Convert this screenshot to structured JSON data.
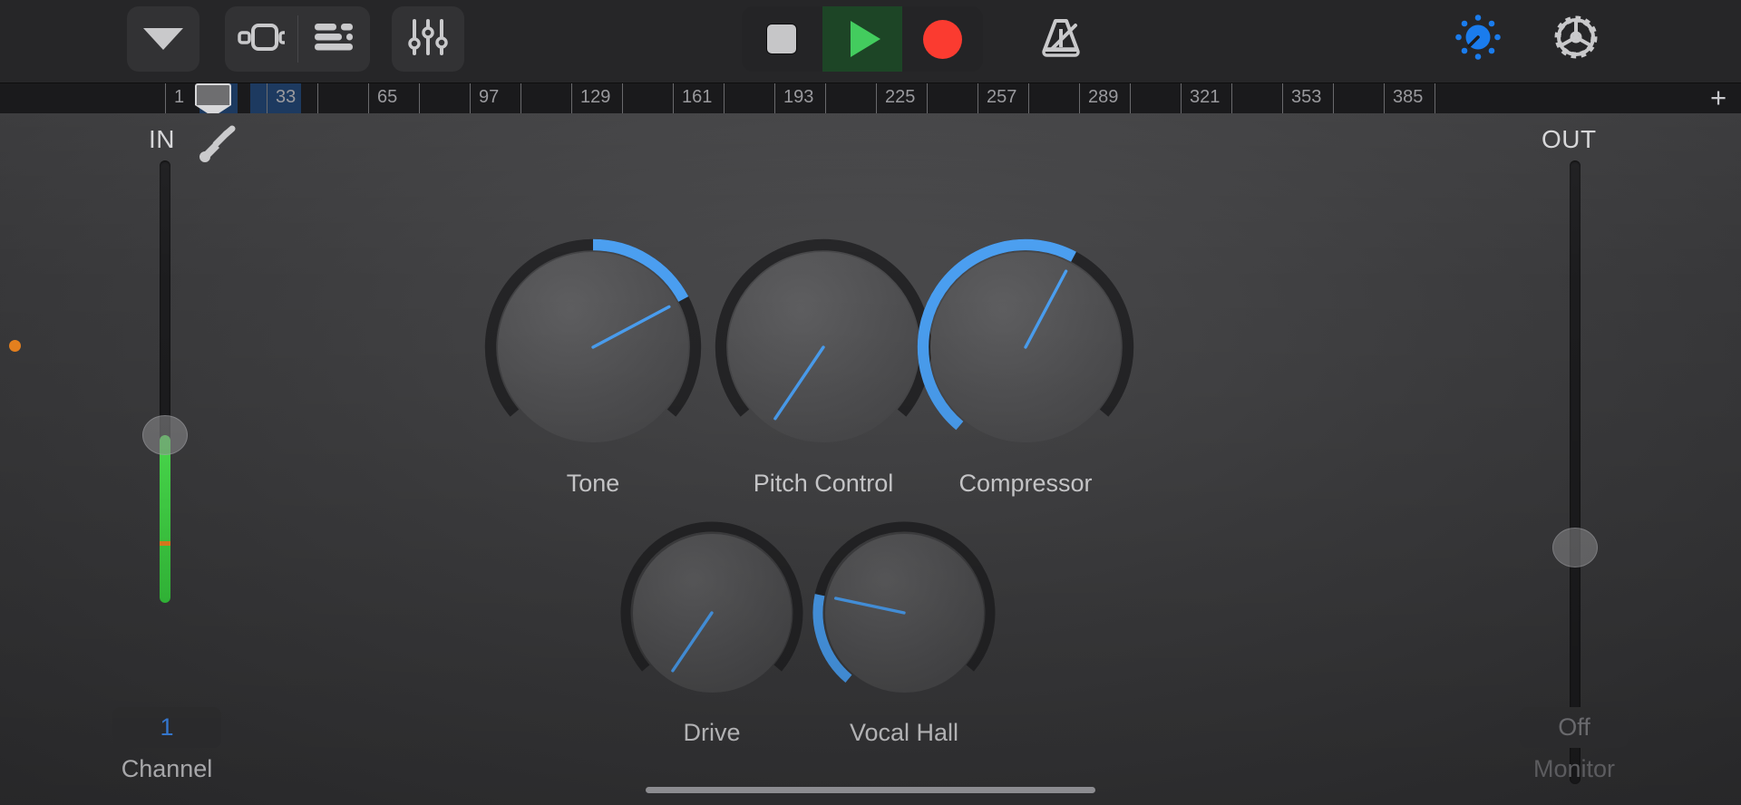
{
  "toolbar": {
    "navigation_button": "chevron-down",
    "tracks_view_button": "tracks-loop-view",
    "list_view_button": "list-view",
    "mixer_button": "mixer-sliders",
    "stop_label": "Stop",
    "play_label": "Play",
    "record_label": "Record",
    "metronome_label": "Metronome",
    "controls_label": "Track Controls",
    "settings_label": "Settings",
    "accent_blue": "#1a7ced",
    "play_green": "#43cc5e",
    "record_red": "#fb3b30"
  },
  "ruler": {
    "bars": [
      "1",
      "33",
      "65",
      "97",
      "129",
      "161",
      "193",
      "225",
      "257",
      "289",
      "321",
      "353",
      "385"
    ],
    "add_button": "+",
    "playhead_bar": "5",
    "cycle_color": "#1d3a60"
  },
  "input": {
    "label": "IN",
    "icon": "input-jack-icon",
    "fader_value": 62,
    "meter_level": 38,
    "peak_marker": 86,
    "channel_value": "1",
    "channel_label": "Channel"
  },
  "output": {
    "label": "OUT",
    "fader_value": 38,
    "monitor_value": "Off",
    "monitor_label": "Monitor"
  },
  "knobs": [
    {
      "label": "Tone",
      "arc_start": 0,
      "arc_end": 62,
      "pointer": 62,
      "has_arc": true,
      "size": 118
    },
    {
      "label": "Pitch Control",
      "arc_start": 0,
      "arc_end": 0,
      "pointer": 214,
      "has_arc": false,
      "size": 118
    },
    {
      "label": "Compressor",
      "arc_start": -140,
      "arc_end": 28,
      "pointer": 28,
      "has_arc": true,
      "size": 118
    },
    {
      "label": "Drive",
      "arc_start": 0,
      "arc_end": 0,
      "pointer": 214,
      "has_arc": false,
      "size": 100
    },
    {
      "label": "Vocal Hall",
      "arc_start": -140,
      "arc_end": -78,
      "pointer": -78,
      "has_arc": true,
      "size": 100
    }
  ]
}
